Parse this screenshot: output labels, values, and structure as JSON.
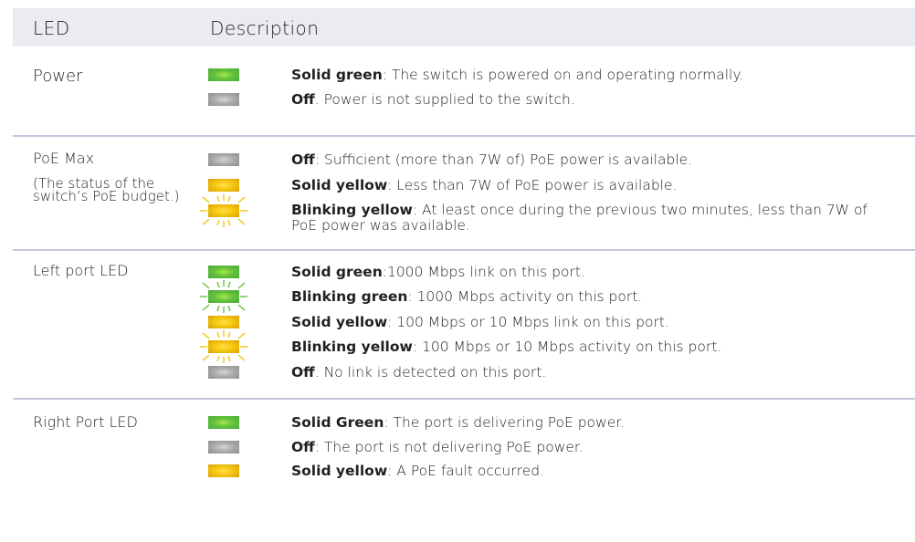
{
  "header": {
    "led": "LED",
    "description": "Description"
  },
  "colors": {
    "header_bg": "#ecebf1",
    "divider": "#c9c5dc",
    "green": "#64c23a",
    "gray": "#a9a9a9",
    "yellow": "#f3c30c"
  },
  "sections": [
    {
      "title": "Power",
      "note": "",
      "rows": [
        {
          "indicator": "green",
          "blinking": false,
          "bold": "Solid green",
          "text": ": The switch is powered on and operating normally."
        },
        {
          "indicator": "gray",
          "blinking": false,
          "bold": "Off",
          "text": ". Power is not supplied to the switch."
        }
      ]
    },
    {
      "title": "PoE Max",
      "note": "(The status of the switch’s PoE budget.)",
      "rows": [
        {
          "indicator": "gray",
          "blinking": false,
          "bold": "Off",
          "text": ": Sufficient (more than 7W of) PoE power is available."
        },
        {
          "indicator": "yellow",
          "blinking": false,
          "bold": "Solid yellow",
          "text": ": Less than 7W of PoE power is available."
        },
        {
          "indicator": "yellow",
          "blinking": true,
          "bold": "Blinking yellow",
          "text": ": At least once during the previous two minutes, less than 7W of PoE power was available."
        }
      ]
    },
    {
      "title": "Left port LED",
      "note": "",
      "rows": [
        {
          "indicator": "green",
          "blinking": false,
          "bold": "Solid green",
          "text": ":1000 Mbps link on this port."
        },
        {
          "indicator": "green",
          "blinking": true,
          "bold": "Blinking green",
          "text": ": 1000 Mbps activity on this port."
        },
        {
          "indicator": "yellow",
          "blinking": false,
          "bold": "Solid yellow",
          "text": ": 100 Mbps or 10 Mbps link on this port."
        },
        {
          "indicator": "yellow",
          "blinking": true,
          "bold": "Blinking yellow",
          "text": ": 100 Mbps or 10 Mbps activity on this port."
        },
        {
          "indicator": "gray",
          "blinking": false,
          "bold": "Off",
          "text": ". No link is detected on this port."
        }
      ]
    },
    {
      "title": "Right Port LED",
      "note": "",
      "rows": [
        {
          "indicator": "green",
          "blinking": false,
          "bold": "Solid Green",
          "text": ": The port is delivering PoE power."
        },
        {
          "indicator": "gray",
          "blinking": false,
          "bold": "Off",
          "text": ": The port is not delivering PoE power."
        },
        {
          "indicator": "yellow",
          "blinking": false,
          "bold": "Solid yellow",
          "text": ": A PoE fault occurred."
        }
      ]
    }
  ]
}
